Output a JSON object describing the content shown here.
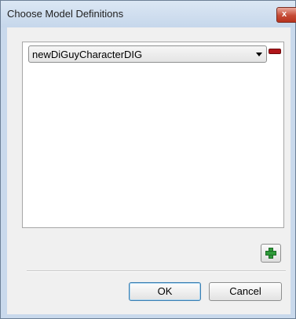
{
  "window": {
    "title": "Choose Model Definitions",
    "close_label": "x"
  },
  "model_list": {
    "selected_value": "newDiGuyCharacterDIG"
  },
  "buttons": {
    "ok_label": "OK",
    "cancel_label": "Cancel"
  },
  "icons": {
    "close": "close-icon",
    "dropdown": "chevron-down-icon",
    "remove": "minus-icon",
    "add": "plus-icon"
  },
  "colors": {
    "remove_red": "#b1161a",
    "add_green": "#2f9a3a",
    "default_button_border": "#3c7fb1"
  }
}
